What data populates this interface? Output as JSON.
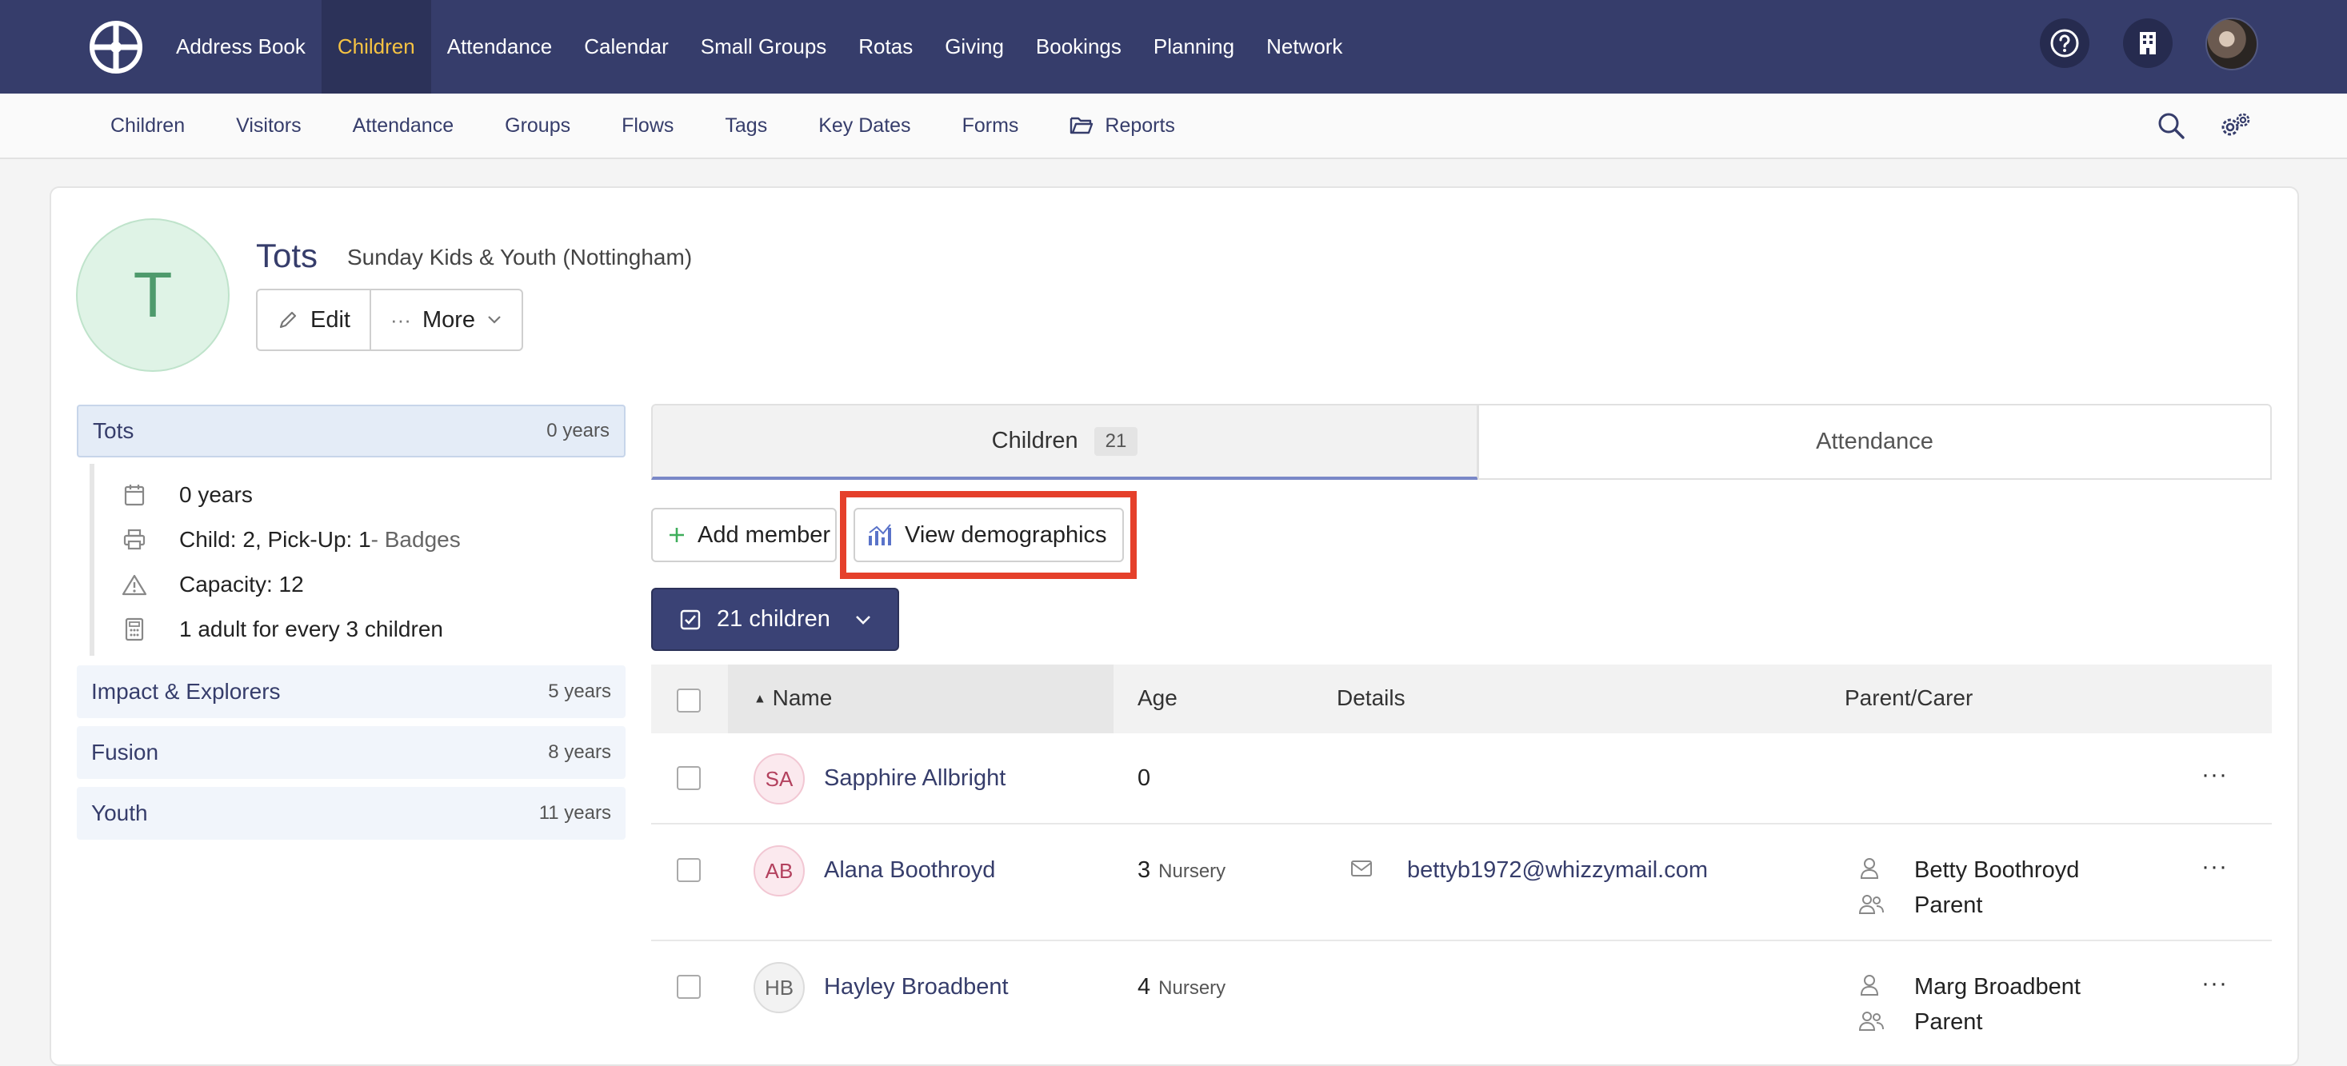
{
  "topnav": {
    "items": [
      "Address Book",
      "Children",
      "Attendance",
      "Calendar",
      "Small Groups",
      "Rotas",
      "Giving",
      "Bookings",
      "Planning",
      "Network"
    ],
    "active": "Children",
    "icons": [
      "logo-icon",
      "help-icon",
      "building-icon",
      "user-avatar"
    ]
  },
  "subnav": {
    "items": [
      "Children",
      "Visitors",
      "Attendance",
      "Groups",
      "Flows",
      "Tags",
      "Key Dates",
      "Forms",
      "Reports"
    ]
  },
  "group": {
    "initial": "T",
    "name": "Tots",
    "subtitle": "Sunday Kids & Youth (Nottingham)",
    "edit_label": "Edit",
    "more_label": "More"
  },
  "sidebar": {
    "groups": [
      {
        "name": "Tots",
        "age": "0 years"
      },
      {
        "name": "Impact & Explorers",
        "age": "5 years"
      },
      {
        "name": "Fusion",
        "age": "8 years"
      },
      {
        "name": "Youth",
        "age": "11 years"
      }
    ],
    "details": {
      "age": "0 years",
      "labels": "Child: 2, Pick-Up: 1",
      "badges": " - Badges",
      "capacity": "Capacity: 12",
      "ratio": "1 adult for every 3 children"
    }
  },
  "tabs": {
    "children_label": "Children",
    "children_count": "21",
    "attendance_label": "Attendance"
  },
  "actions": {
    "add_member": "Add member",
    "view_demographics": "View demographics",
    "select_label": "21 children"
  },
  "table": {
    "headers": {
      "name": "Name",
      "age": "Age",
      "details": "Details",
      "parent": "Parent/Carer"
    },
    "rows": [
      {
        "initials": "SA",
        "name": "Sapphire Allbright",
        "age": "0",
        "grade": "",
        "email": "",
        "parent": "",
        "relation": ""
      },
      {
        "initials": "AB",
        "name": "Alana Boothroyd",
        "age": "3",
        "grade": "Nursery",
        "email": "bettyb1972@whizzymail.com",
        "parent": "Betty Boothroyd",
        "relation": "Parent"
      },
      {
        "initials": "HB",
        "name": "Hayley Broadbent",
        "age": "4",
        "grade": "Nursery",
        "email": "",
        "parent": "Marg Broadbent",
        "relation": "Parent"
      }
    ]
  },
  "colors": {
    "nav_bg": "#363d6b",
    "active_nav_text": "#f6c343",
    "highlight": "#e5402b",
    "link": "#363d6b"
  }
}
